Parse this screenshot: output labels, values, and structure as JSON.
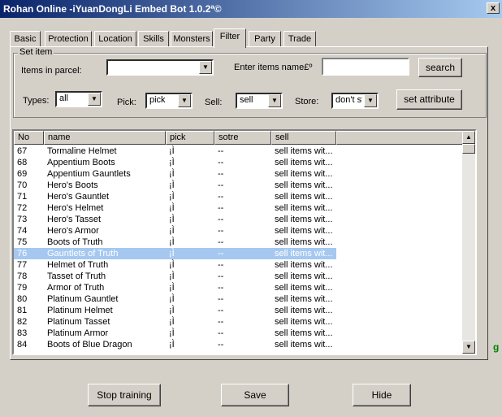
{
  "window": {
    "title": "Rohan Online -iYuanDongLi Embed Bot 1.0.2ª©",
    "close_glyph": "x"
  },
  "tabs": [
    {
      "label": "Basic"
    },
    {
      "label": "Protection"
    },
    {
      "label": "Location"
    },
    {
      "label": "Skills"
    },
    {
      "label": "Monsters"
    },
    {
      "label": "Filter"
    },
    {
      "label": "Party"
    },
    {
      "label": "Trade"
    }
  ],
  "active_tab": "Filter",
  "set_item": {
    "group_label": "Set item",
    "items_in_parcel_label": "Items in parcel:",
    "items_in_parcel_value": "",
    "enter_name_label": "Enter items name£º",
    "enter_name_value": "",
    "search_label": "search",
    "types_label": "Types:",
    "types_value": "all",
    "pick_label": "Pick:",
    "pick_value": "pick",
    "sell_label": "Sell:",
    "sell_value": "sell",
    "store_label": "Store:",
    "store_value": "don't sto",
    "set_attribute_label": "set attribute"
  },
  "list": {
    "columns": [
      "No",
      "name",
      "pick",
      "sotre",
      "sell"
    ],
    "selected_no": "76",
    "rows": [
      {
        "no": "67",
        "name": "Tormaline Helmet",
        "pick": "¡Ì",
        "store": "--",
        "sell": "sell items wit..."
      },
      {
        "no": "68",
        "name": "Appentium Boots",
        "pick": "¡Ì",
        "store": "--",
        "sell": "sell items wit..."
      },
      {
        "no": "69",
        "name": "Appentium Gauntlets",
        "pick": "¡Ì",
        "store": "--",
        "sell": "sell items wit..."
      },
      {
        "no": "70",
        "name": "Hero's Boots",
        "pick": "¡Ì",
        "store": "--",
        "sell": "sell items wit..."
      },
      {
        "no": "71",
        "name": "Hero's Gauntlet",
        "pick": "¡Ì",
        "store": "--",
        "sell": "sell items wit..."
      },
      {
        "no": "72",
        "name": "Hero's Helmet",
        "pick": "¡Ì",
        "store": "--",
        "sell": "sell items wit..."
      },
      {
        "no": "73",
        "name": "Hero's Tasset",
        "pick": "¡Ì",
        "store": "--",
        "sell": "sell items wit..."
      },
      {
        "no": "74",
        "name": "Hero's Armor",
        "pick": "¡Ì",
        "store": "--",
        "sell": "sell items wit..."
      },
      {
        "no": "75",
        "name": "Boots of Truth",
        "pick": "¡Ì",
        "store": "--",
        "sell": "sell items wit..."
      },
      {
        "no": "76",
        "name": "Gauntlets of Truth",
        "pick": "¡Ì",
        "store": "--",
        "sell": "sell items wit..."
      },
      {
        "no": "77",
        "name": "Helmet of Truth",
        "pick": "¡Ì",
        "store": "--",
        "sell": "sell items wit..."
      },
      {
        "no": "78",
        "name": "Tasset of Truth",
        "pick": "¡Ì",
        "store": "--",
        "sell": "sell items wit..."
      },
      {
        "no": "79",
        "name": "Armor of Truth",
        "pick": "¡Ì",
        "store": "--",
        "sell": "sell items wit..."
      },
      {
        "no": "80",
        "name": "Platinum Gauntlet",
        "pick": "¡Ì",
        "store": "--",
        "sell": "sell items wit..."
      },
      {
        "no": "81",
        "name": "Platinum Helmet",
        "pick": "¡Ì",
        "store": "--",
        "sell": "sell items wit..."
      },
      {
        "no": "82",
        "name": "Platinum Tasset",
        "pick": "¡Ì",
        "store": "--",
        "sell": "sell items wit..."
      },
      {
        "no": "83",
        "name": "Platinum Armor",
        "pick": "¡Ì",
        "store": "--",
        "sell": "sell items wit..."
      },
      {
        "no": "84",
        "name": "Boots of Blue Dragon",
        "pick": "¡Ì",
        "store": "--",
        "sell": "sell items wit..."
      }
    ]
  },
  "buttons": {
    "stop_training": "Stop training",
    "save": "Save",
    "hide": "Hide"
  },
  "side_text": "g",
  "glyphs": {
    "down": "▼",
    "up": "▲"
  },
  "colors": {
    "titlebar_start": "#0a246a",
    "selection": "#a6c8f0",
    "face": "#d4d0c8"
  }
}
